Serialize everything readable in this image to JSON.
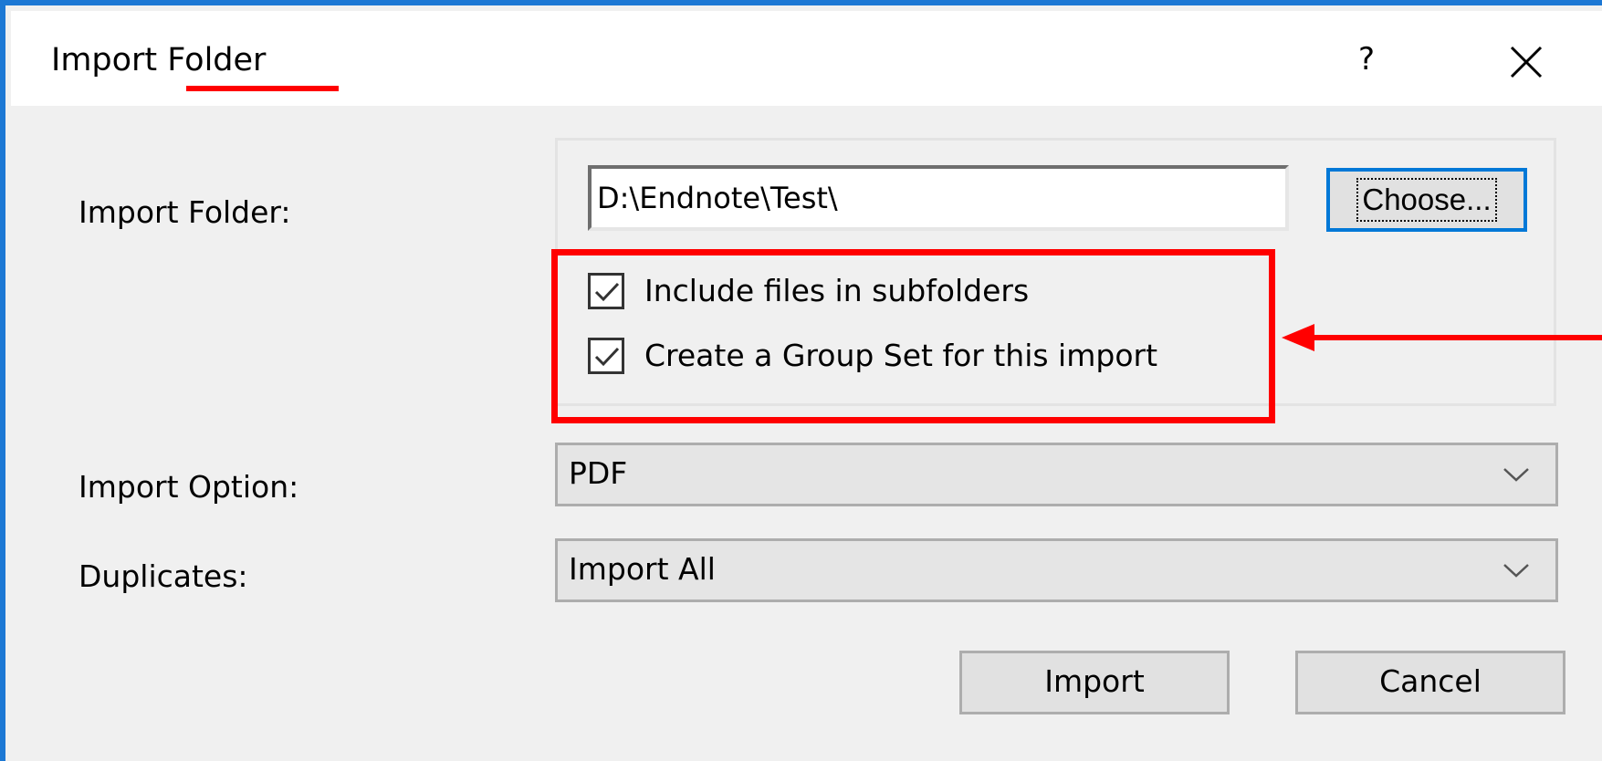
{
  "window": {
    "title": "Import Folder",
    "help_label": "?",
    "close_icon": "close-icon"
  },
  "form": {
    "folder_label": "Import Folder:",
    "folder_value": "D:\\Endnote\\Test\\",
    "choose_label": "Choose...",
    "include_subfolders": {
      "label": "Include files in subfolders",
      "checked": true
    },
    "create_group_set": {
      "label": "Create a Group Set for this import",
      "checked": true
    },
    "option_label": "Import Option:",
    "option_value": "PDF",
    "duplicates_label": "Duplicates:",
    "duplicates_value": "Import All"
  },
  "buttons": {
    "import_label": "Import",
    "cancel_label": "Cancel"
  },
  "annotations": {
    "highlight_color": "#ff0000",
    "window_border_color": "#1c78d4"
  }
}
